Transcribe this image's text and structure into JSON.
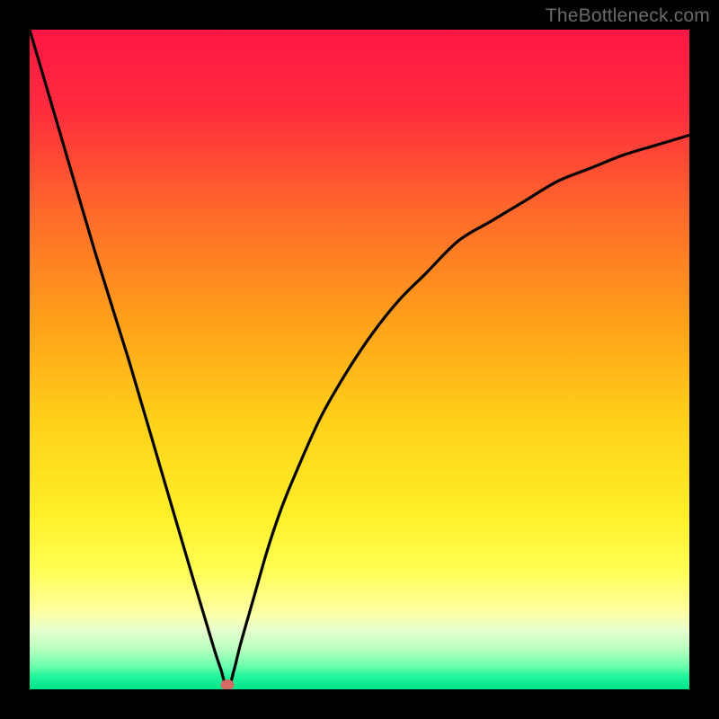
{
  "watermark": "TheBottleneck.com",
  "marker": {
    "x_pct": 30.0,
    "y_pct": 99.3,
    "color": "#d36a63"
  },
  "chart_data": {
    "type": "line",
    "title": "",
    "xlabel": "",
    "ylabel": "",
    "ylim": [
      0,
      100
    ],
    "xlim": [
      0,
      100
    ],
    "series": [
      {
        "name": "bottleneck_curve",
        "x": [
          0,
          5,
          10,
          15,
          20,
          25,
          28,
          29,
          30,
          31,
          32,
          34,
          36,
          38,
          40,
          44,
          48,
          52,
          56,
          60,
          65,
          70,
          75,
          80,
          85,
          90,
          95,
          100
        ],
        "y": [
          100,
          83,
          66,
          50,
          33,
          16,
          6,
          3,
          0,
          3,
          7,
          14,
          21,
          27,
          32,
          41,
          48,
          54,
          59,
          63,
          68,
          71,
          74,
          77,
          79,
          81,
          82.5,
          84
        ]
      }
    ],
    "gradient_stops": [
      {
        "pct": 0,
        "color": "#ff1744"
      },
      {
        "pct": 12,
        "color": "#ff2b3f"
      },
      {
        "pct": 28,
        "color": "#ff6a2a"
      },
      {
        "pct": 45,
        "color": "#ffa31a"
      },
      {
        "pct": 60,
        "color": "#ffd21a"
      },
      {
        "pct": 74,
        "color": "#fff02a"
      },
      {
        "pct": 82,
        "color": "#ffff55"
      },
      {
        "pct": 88,
        "color": "#ffffa0"
      },
      {
        "pct": 91,
        "color": "#e8ffce"
      },
      {
        "pct": 94,
        "color": "#b6ffc0"
      },
      {
        "pct": 96.5,
        "color": "#6affad"
      },
      {
        "pct": 98,
        "color": "#23f59d"
      },
      {
        "pct": 100,
        "color": "#00e58a"
      }
    ]
  }
}
